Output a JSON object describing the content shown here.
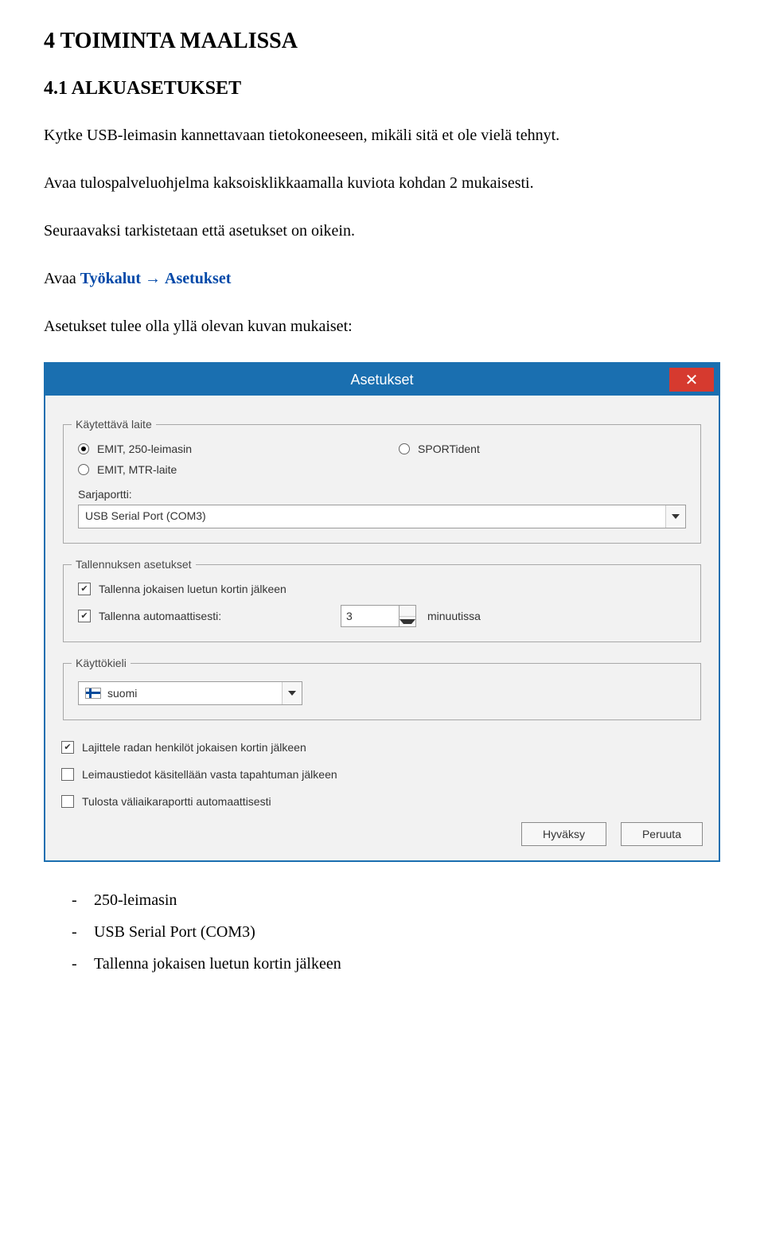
{
  "doc": {
    "h2": "4  TOIMINTA MAALISSA",
    "h3": "4.1  ALKUASETUKSET",
    "p1": "Kytke USB-leimasin kannettavaan tietokoneeseen, mikäli sitä et ole vielä tehnyt.",
    "p2": "Avaa tulospalveluohjelma kaksoisklikkaamalla kuviota kohdan 2 mukaisesti.",
    "p3": "Seuraavaksi tarkistetaan että asetukset on oikein.",
    "p4_pre": "Avaa ",
    "p4_link1": "Työkalut",
    "p4_arrow": "→",
    "p4_link2": "Asetukset",
    "p5": "Asetukset tulee olla yllä olevan kuvan mukaiset:"
  },
  "dialog": {
    "title": "Asetukset",
    "close": "✕",
    "group_device": "Käytettävä laite",
    "radio1": "EMIT, 250-leimasin",
    "radio2": "SPORTident",
    "radio3": "EMIT, MTR-laite",
    "serial_label": "Sarjaportti:",
    "serial_value": "USB Serial Port (COM3)",
    "group_saving": "Tallennuksen asetukset",
    "chk_after_card": "Tallenna jokaisen luetun kortin jälkeen",
    "chk_auto": "Tallenna automaattisesti:",
    "auto_value": "3",
    "minutes": "minuutissa",
    "group_lang": "Käyttökieli",
    "lang_value": "suomi",
    "chk_sort": "Lajittele radan henkilöt jokaisen kortin jälkeen",
    "chk_stamp": "Leimaustiedot käsitellään vasta tapahtuman jälkeen",
    "chk_print": "Tulosta väliaikaraportti automaattisesti",
    "btn_ok": "Hyväksy",
    "btn_cancel": "Peruuta"
  },
  "bullets": {
    "b1": "250-leimasin",
    "b2": "USB Serial Port (COM3)",
    "b3": "Tallenna jokaisen luetun kortin jälkeen"
  }
}
